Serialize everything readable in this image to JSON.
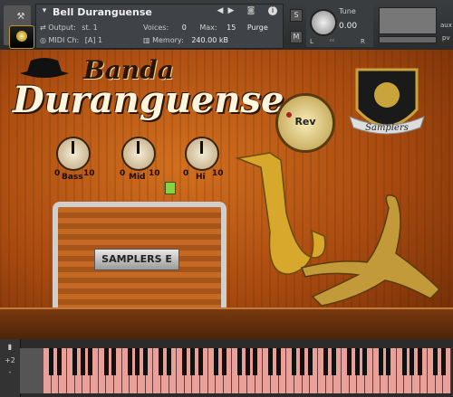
{
  "header": {
    "instrument_name": "Bell Duranguense",
    "output_label": "Output:",
    "output_value": "st. 1",
    "midi_label": "MIDI Ch:",
    "midi_value": "[A]  1",
    "voices_label": "Voices:",
    "voices_value": "0",
    "max_label": "Max:",
    "max_value": "15",
    "purge_label": "Purge",
    "memory_label": "Memory:",
    "memory_value": "240.00 kB",
    "tune_label": "Tune",
    "tune_value": "0.00",
    "s_btn": "S",
    "m_btn": "M",
    "aux_label": "aux",
    "pv_label": "pv",
    "l_label": "L",
    "r_label": "R"
  },
  "main": {
    "brand_line1": "Banda",
    "brand_line2": "Duranguense",
    "knobs": [
      {
        "label": "Bass",
        "min": "0",
        "max": "10"
      },
      {
        "label": "Mid",
        "min": "0",
        "max": "10"
      },
      {
        "label": "Hi",
        "min": "0",
        "max": "10"
      }
    ],
    "reverb_label": "Rev",
    "logo_text": "Samplers",
    "drum_label": "SAMPLERS E"
  },
  "keyboard": {
    "octave_up": "+2",
    "octave_down": "-"
  },
  "colors": {
    "wood": "#b8561a",
    "key_tint": "#e8a098",
    "header_bg": "#3a3d40"
  }
}
